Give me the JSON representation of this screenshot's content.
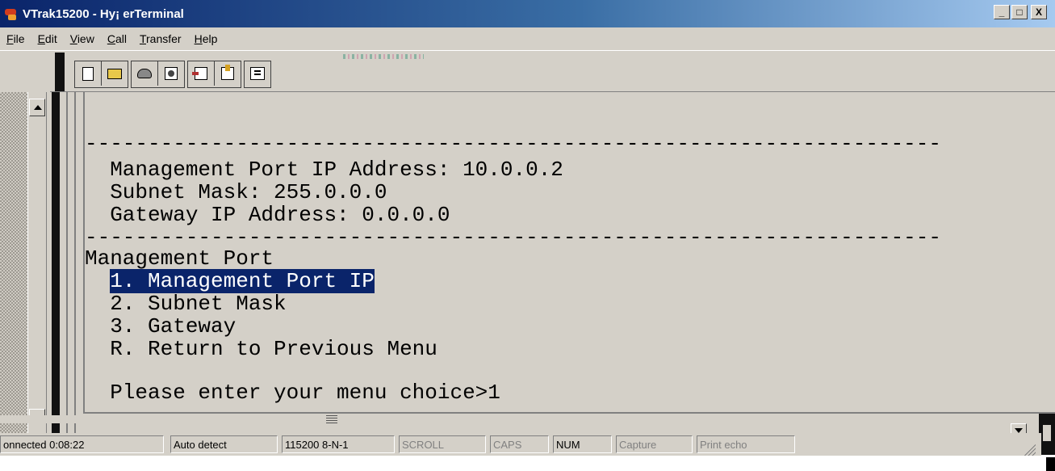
{
  "window": {
    "title": "VTrak15200 - Hу¡ erTerminal",
    "controls": {
      "minimize": "_",
      "maximize": "□",
      "close": "X"
    }
  },
  "menubar": {
    "items": [
      {
        "label_first": "F",
        "label_rest": "ile"
      },
      {
        "label_first": "E",
        "label_rest": "dit"
      },
      {
        "label_first": "V",
        "label_rest": "iew"
      },
      {
        "label_first": "C",
        "label_rest": "all"
      },
      {
        "label_first": "T",
        "label_rest": "ransfer"
      },
      {
        "label_first": "H",
        "label_rest": "elp"
      }
    ]
  },
  "toolbar": {
    "buttons": [
      "new-icon",
      "open-icon",
      "connect-icon",
      "disconnect-icon",
      "send-icon",
      "receive-icon",
      "properties-icon"
    ]
  },
  "terminal": {
    "lines": [
      "--------------------------------------------------------------------",
      "  Management Port IP Address: 10.0.0.2",
      "  Subnet Mask: 255.0.0.0",
      "  Gateway IP Address: 0.0.0.0",
      "--------------------------------------------------------------------",
      "Management Port",
      "  1. Management Port IP",
      "  2. Subnet Mask",
      "  3. Gateway",
      "  R. Return to Previous Menu",
      "",
      "  Please enter your menu choice>1"
    ],
    "selected_prefix": "  ",
    "selected_text": "1. Management Port IP"
  },
  "statusbar": {
    "connection": "onnected 0:08:22",
    "emulation": "Auto detect",
    "port_settings": "115200 8-N-1",
    "scroll": "SCROLL",
    "caps": "CAPS",
    "num": "NUM",
    "capture": "Capture",
    "print_echo": "Print echo"
  }
}
